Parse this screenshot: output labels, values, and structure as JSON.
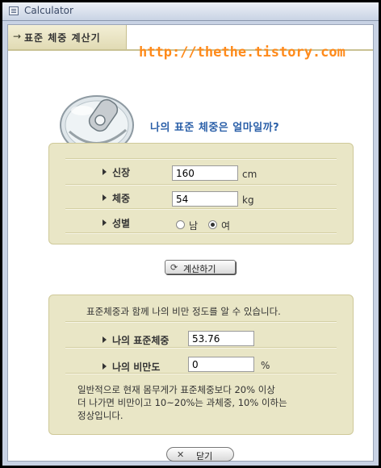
{
  "window": {
    "title": "Calculator"
  },
  "header": {
    "section_title": "표준 체중 계산기",
    "arrow": "→",
    "site_url": "http://thethe.tistory.com"
  },
  "hero": {
    "question": "나의 표준 체중은 얼마일까?"
  },
  "form": {
    "height": {
      "label": "신장",
      "value": "160",
      "unit": "cm"
    },
    "weight": {
      "label": "체중",
      "value": "54",
      "unit": "kg"
    },
    "gender": {
      "label": "성별",
      "options": [
        "남",
        "여"
      ],
      "selected": "여"
    }
  },
  "calculate_button": {
    "label": "계산하기"
  },
  "result": {
    "intro": "표준체중과 함께 나의 비만 정도를 알 수 있습니다.",
    "standard_weight": {
      "label": "나의 표준체중",
      "value": "53.76"
    },
    "obesity": {
      "label": "나의 비만도",
      "value": "0",
      "unit": "%"
    },
    "note_lines": [
      "일반적으로 현재 몸무게가 표준체중보다 20% 이상",
      "더 나가면 비만이고 10~20%는 과체중, 10% 이하는",
      "정상입니다."
    ]
  },
  "close_button": {
    "label": "닫기"
  }
}
